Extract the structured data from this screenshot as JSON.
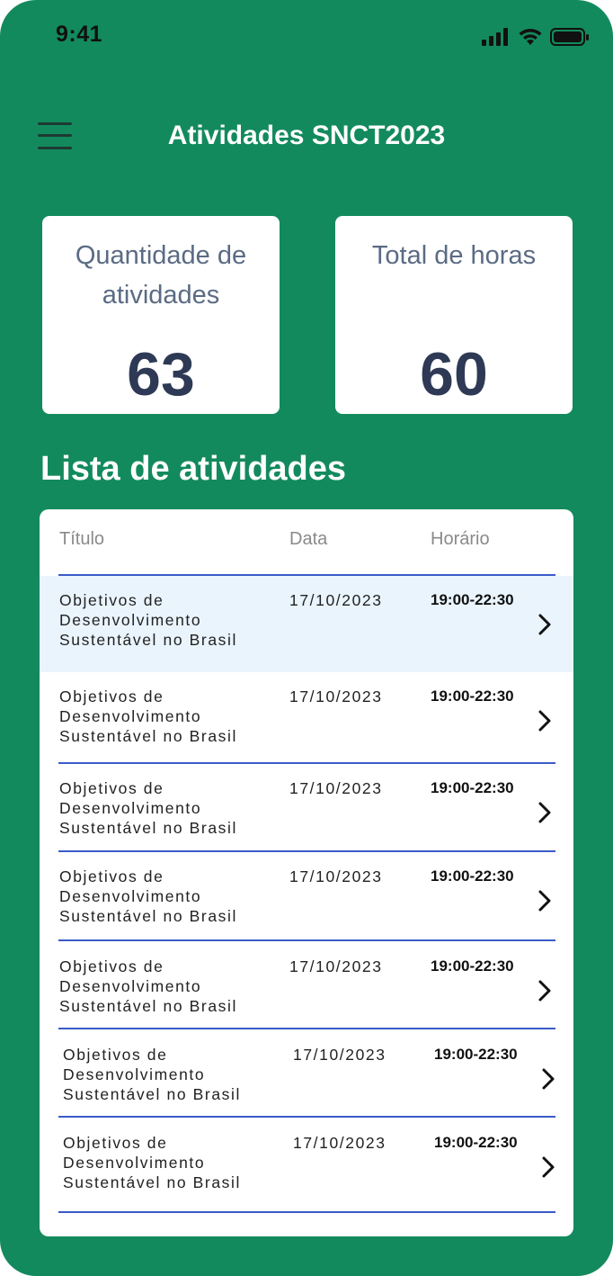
{
  "status_bar": {
    "time": "9:41"
  },
  "header": {
    "title": "Atividades SNCT2023"
  },
  "stats": [
    {
      "label": "Quantidade de atividades",
      "value": "63"
    },
    {
      "label": "Total de horas",
      "value": "60"
    }
  ],
  "list": {
    "title": "Lista de atividades",
    "columns": [
      "Título",
      "Data",
      "Horário"
    ],
    "rows": [
      {
        "title": "Objetivos de Desenvolvimento Sustentável no Brasil",
        "date": "17/10/2023",
        "time": "19:00-22:30"
      },
      {
        "title": "Objetivos de Desenvolvimento Sustentável no Brasil",
        "date": "17/10/2023",
        "time": "19:00-22:30"
      },
      {
        "title": "Objetivos de Desenvolvimento Sustentável no Brasil",
        "date": "17/10/2023",
        "time": "19:00-22:30"
      },
      {
        "title": "Objetivos de Desenvolvimento Sustentável no Brasil",
        "date": "17/10/2023",
        "time": "19:00-22:30"
      },
      {
        "title": "Objetivos de Desenvolvimento Sustentável no Brasil",
        "date": "17/10/2023",
        "time": "19:00-22:30"
      },
      {
        "title": "Objetivos de Desenvolvimento Sustentável no Brasil",
        "date": "17/10/2023",
        "time": "19:00-22:30"
      },
      {
        "title": "Objetivos de Desenvolvimento Sustentável no Brasil",
        "date": "17/10/2023",
        "time": "19:00-22:30"
      }
    ]
  },
  "colors": {
    "background": "#138a5e",
    "card": "#ffffff",
    "divider": "#3b5bc7",
    "highlight_row": "#eaf4fd",
    "stat_number": "#2e3a55"
  },
  "icons": [
    "menu-icon",
    "signal-icon",
    "wifi-icon",
    "battery-icon",
    "chevron-right-icon"
  ]
}
